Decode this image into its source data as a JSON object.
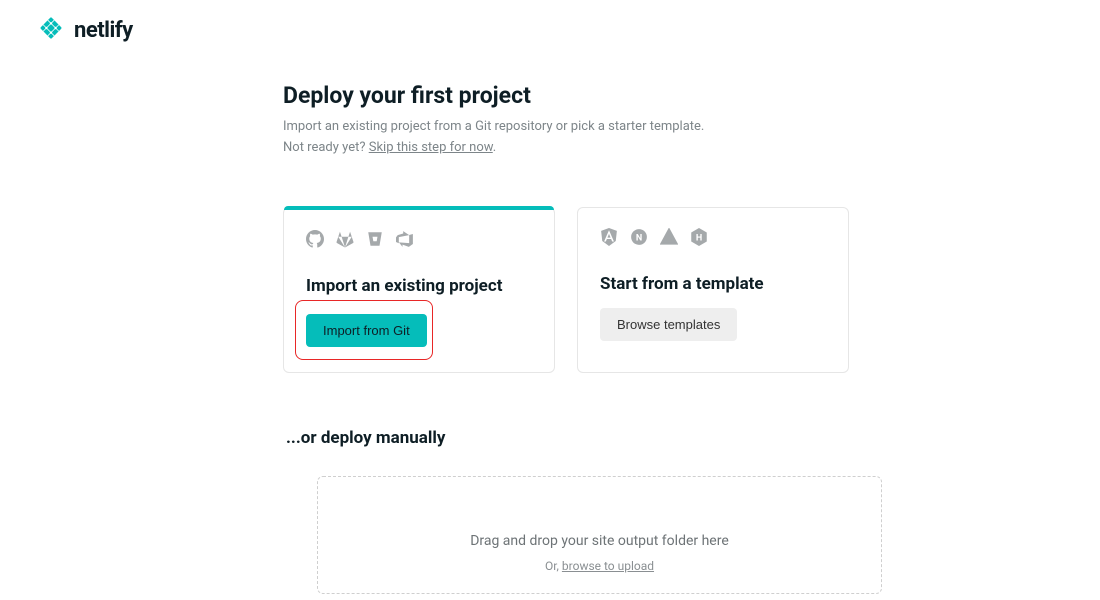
{
  "brand": {
    "name": "netlify",
    "accent_color": "#05bdba"
  },
  "page": {
    "title": "Deploy your first project",
    "subtitle_line1": "Import an existing project from a Git repository or pick a starter template.",
    "subtitle_line2_prefix": "Not ready yet? ",
    "skip_link_text": "Skip this step for now",
    "skip_link_suffix": "."
  },
  "cards": {
    "import": {
      "title": "Import an existing project",
      "button_label": "Import from Git",
      "icons": [
        "github",
        "gitlab",
        "bitbucket",
        "azure-devops"
      ]
    },
    "template": {
      "title": "Start from a template",
      "button_label": "Browse templates",
      "icons": [
        "angular",
        "nuxt",
        "gatsby",
        "hugo"
      ]
    }
  },
  "manual": {
    "section_title": "...or deploy manually",
    "dropzone_main": "Drag and drop your site output folder here",
    "dropzone_prefix": "Or, ",
    "browse_link": "browse to upload"
  }
}
